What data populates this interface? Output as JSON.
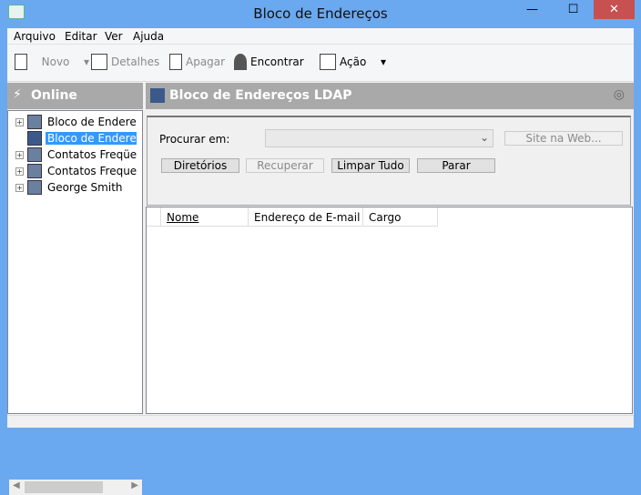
{
  "window": {
    "title": "Bloco de Endereços",
    "minimize": "—",
    "maximize": "☐",
    "close": "✕"
  },
  "menu": [
    "Arquivo",
    "Editar",
    "Ver",
    "Ajuda"
  ],
  "toolbar": {
    "new": "Novo",
    "details": "Detalhes",
    "delete": "Apagar",
    "find": "Encontrar",
    "action": "Ação"
  },
  "left": {
    "header": "Online",
    "items": [
      "Bloco de Endereços",
      "Bloco de Endereços",
      "Contatos Freqüentes",
      "Contatos Frequentes",
      "George Smith"
    ]
  },
  "right": {
    "header": "Bloco de Endereços LDAP",
    "search_label": "Procurar em:",
    "website": "Site na Web...",
    "buttons": [
      "Diretórios",
      "Recuperar",
      "Limpar Tudo",
      "Parar"
    ],
    "columns": [
      "Nome",
      "Endereço de E-mail",
      "Cargo"
    ]
  }
}
